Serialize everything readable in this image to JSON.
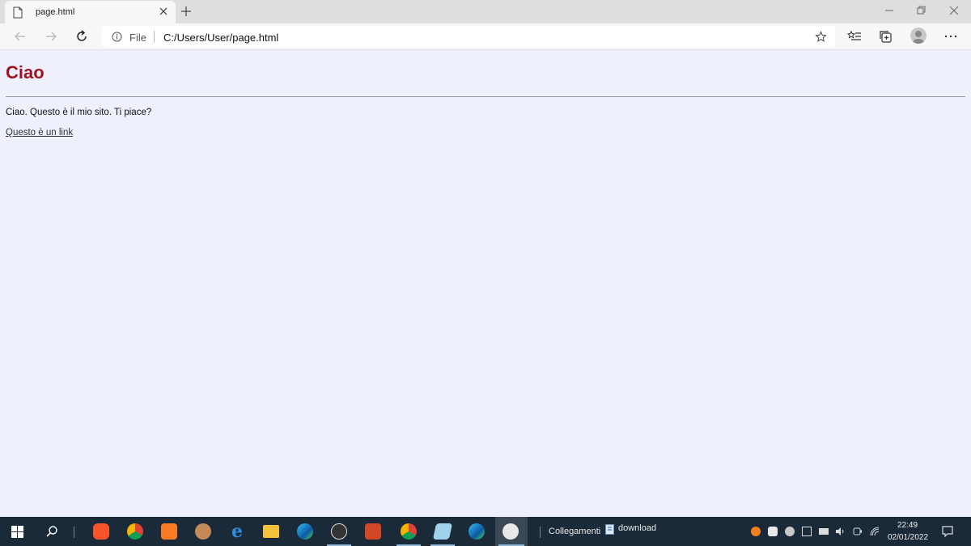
{
  "browser": {
    "tab_title": "page.html",
    "address_scheme": "File",
    "address_url": "C:/Users/User/page.html"
  },
  "page": {
    "heading": "Ciao",
    "paragraph": "Ciao. Questo è il mio sito. Ti piace?",
    "link_text": "Questo è un link"
  },
  "colors": {
    "heading": "#9c1420",
    "page_background": "#eef0fc",
    "taskbar": "#1b2a39"
  },
  "taskbar": {
    "pinned_apps": [
      "start-icon",
      "search-icon",
      "brave-icon",
      "chrome-icon",
      "xampp-icon",
      "web-icon",
      "internet-explorer-icon",
      "file-explorer-icon",
      "edge-icon",
      "w-app-icon",
      "powerpoint-icon",
      "chrome-notification-icon",
      "notes-icon",
      "edge-icon",
      "photos-icon"
    ],
    "toolbar_label_1": "Collegamenti",
    "toolbar_label_2": "download",
    "time": "22:49",
    "date": "02/01/2022"
  }
}
